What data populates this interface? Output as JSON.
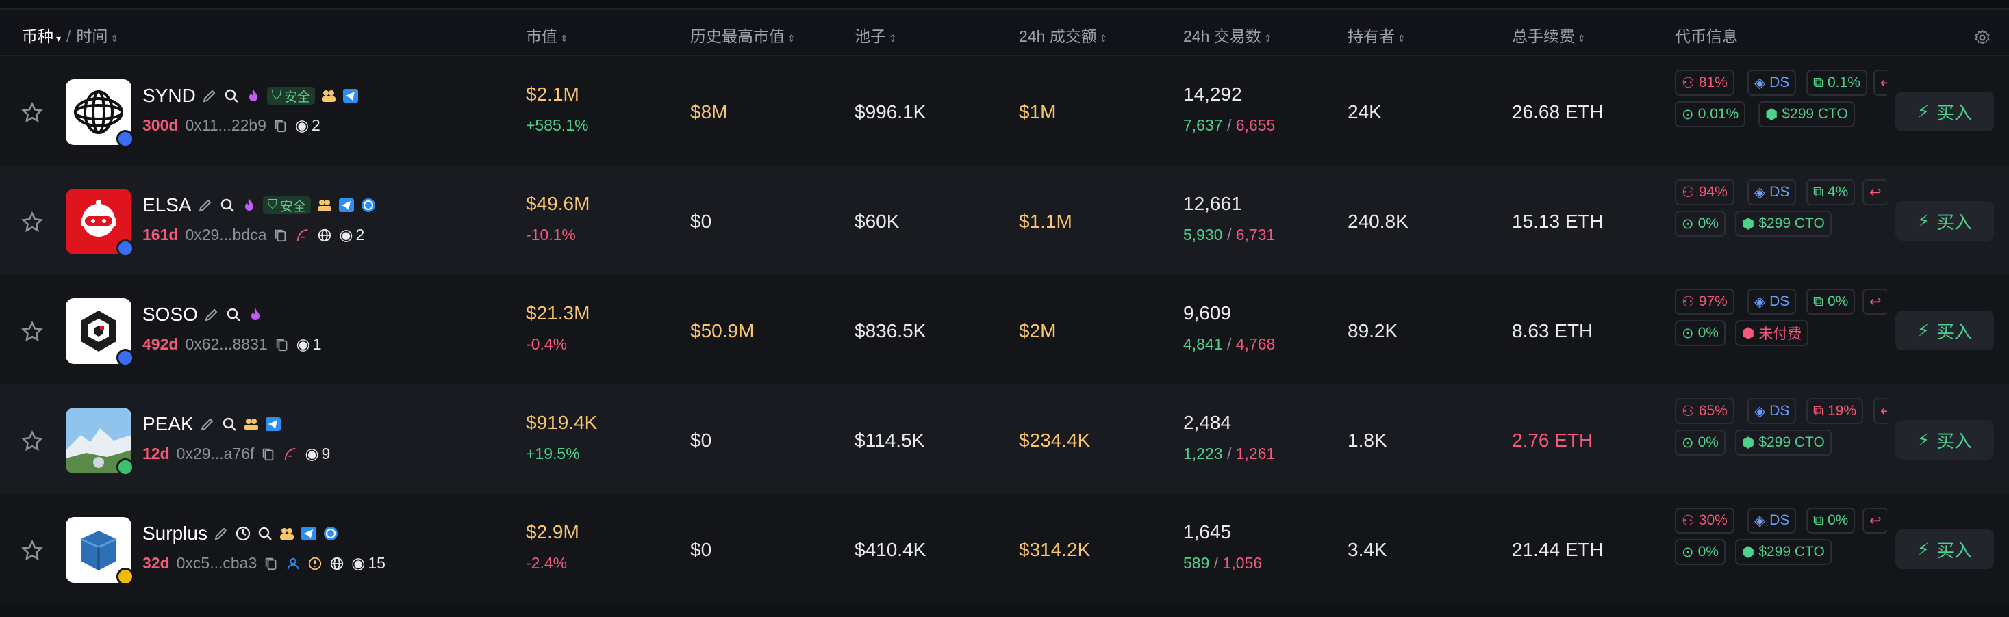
{
  "header": {
    "col_coin": "币种",
    "col_time": "时间",
    "col_mcap": "市值",
    "col_ath": "历史最高市值",
    "col_pool": "池子",
    "col_volume": "24h 成交额",
    "col_txs": "24h 交易数",
    "col_holders": "持有者",
    "col_fees": "总手续费",
    "col_info": "代币信息"
  },
  "buy_label": "买入",
  "safe_label": "安全",
  "rows": [
    {
      "name": "SYND",
      "age": "300d",
      "address": "0x11...22b9",
      "watchers": "2",
      "market_cap": "$2.1M",
      "change": "+585.1%",
      "ath": "$8M",
      "pool": "$996.1K",
      "volume": "$1M",
      "txs": "14,292",
      "buys": "7,637",
      "sells": "6,655",
      "holders": "24K",
      "fees": "26.68 ETH",
      "info": {
        "top": "81%",
        "dev": "DS",
        "insider": "0.1%",
        "sniper": "0.01%",
        "status": "$299 CTO"
      }
    },
    {
      "name": "ELSA",
      "age": "161d",
      "address": "0x29...bdca",
      "watchers": "2",
      "market_cap": "$49.6M",
      "change": "-10.1%",
      "ath": "$0",
      "pool": "$60K",
      "volume": "$1.1M",
      "txs": "12,661",
      "buys": "5,930",
      "sells": "6,731",
      "holders": "240.8K",
      "fees": "15.13 ETH",
      "info": {
        "top": "94%",
        "dev": "DS",
        "insider": "4%",
        "sniper": "0%",
        "status": "$299 CTO"
      }
    },
    {
      "name": "SOSO",
      "age": "492d",
      "address": "0x62...8831",
      "watchers": "1",
      "market_cap": "$21.3M",
      "change": "-0.4%",
      "ath": "$50.9M",
      "pool": "$836.5K",
      "volume": "$2M",
      "txs": "9,609",
      "buys": "4,841",
      "sells": "4,768",
      "holders": "89.2K",
      "fees": "8.63 ETH",
      "info": {
        "top": "97%",
        "dev": "DS",
        "insider": "0%",
        "sniper": "0%",
        "status": "未付费"
      }
    },
    {
      "name": "PEAK",
      "age": "12d",
      "address": "0x29...a76f",
      "watchers": "9",
      "market_cap": "$919.4K",
      "change": "+19.5%",
      "ath": "$0",
      "pool": "$114.5K",
      "volume": "$234.4K",
      "txs": "2,484",
      "buys": "1,223",
      "sells": "1,261",
      "holders": "1.8K",
      "fees": "2.76 ETH",
      "info": {
        "top": "65%",
        "dev": "DS",
        "insider": "19%",
        "sniper": "0%",
        "status": "$299 CTO"
      }
    },
    {
      "name": "Surplus",
      "age": "32d",
      "address": "0xc5...cba3",
      "watchers": "15",
      "market_cap": "$2.9M",
      "change": "-2.4%",
      "ath": "$0",
      "pool": "$410.4K",
      "volume": "$314.2K",
      "txs": "1,645",
      "buys": "589",
      "sells": "1,056",
      "holders": "3.4K",
      "fees": "21.44 ETH",
      "info": {
        "top": "30%",
        "dev": "DS",
        "insider": "0%",
        "sniper": "0%",
        "status": "$299 CTO"
      }
    }
  ],
  "colors": {
    "gold": "#f7c56b",
    "green": "#4ed18d",
    "red": "#f2597a",
    "blue": "#6aa0ff",
    "bg": "#111216"
  }
}
